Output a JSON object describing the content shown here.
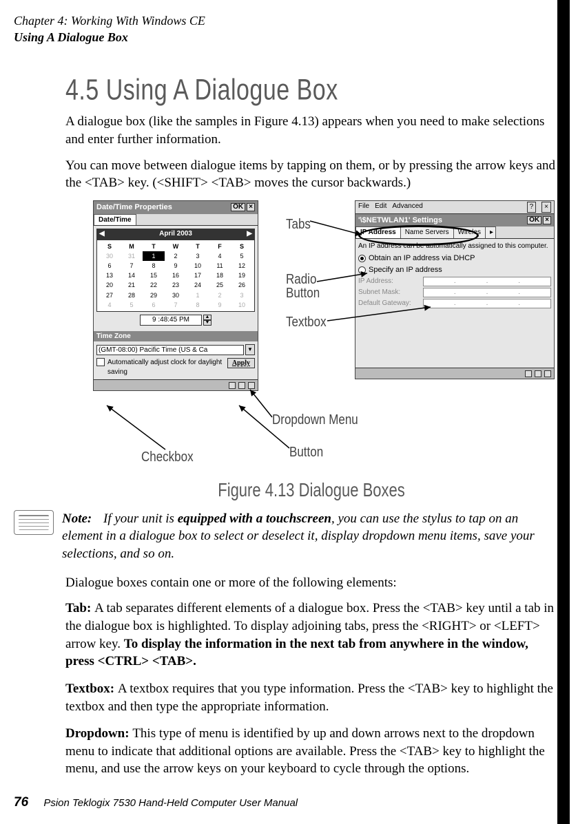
{
  "header": {
    "chapter": "Chapter 4: Working With Windows CE",
    "section": "Using A Dialogue Box"
  },
  "title": "4.5  Using A Dialogue Box",
  "intro1": "A dialogue box (like the samples in Figure 4.13) appears when you need to make selections and enter further information.",
  "intro2": "You can move between dialogue items by tapping on them, or by pressing the arrow keys and the <TAB> key. (<SHIFT> <TAB> moves the cursor backwards.)",
  "figure_caption": "Figure 4.13 Dialogue Boxes",
  "anno": {
    "tabs": "Tabs",
    "radio": "Radio",
    "radio2": "Button",
    "textbox": "Textbox",
    "dropdown": "Dropdown Menu",
    "checkbox": "Checkbox",
    "button": "Button"
  },
  "panel1": {
    "title": "Date/Time Properties",
    "ok": "OK",
    "close": "×",
    "tab": "Date/Time",
    "month": "April 2003",
    "days": [
      "S",
      "M",
      "T",
      "W",
      "T",
      "F",
      "S"
    ],
    "grid": [
      [
        "30",
        "31",
        "1",
        "2",
        "3",
        "4",
        "5"
      ],
      [
        "6",
        "7",
        "8",
        "9",
        "10",
        "11",
        "12"
      ],
      [
        "13",
        "14",
        "15",
        "16",
        "17",
        "18",
        "19"
      ],
      [
        "20",
        "21",
        "22",
        "23",
        "24",
        "25",
        "26"
      ],
      [
        "27",
        "28",
        "29",
        "30",
        "1",
        "2",
        "3"
      ],
      [
        "4",
        "5",
        "6",
        "7",
        "8",
        "9",
        "10"
      ]
    ],
    "time": "9 :48:45 PM",
    "tz_head": "Time Zone",
    "tz_value": "(GMT-08:00) Pacific Time (US & Ca",
    "check_label": "Automatically adjust clock for daylight saving",
    "apply": "Apply"
  },
  "panel2": {
    "menu": [
      "File",
      "Edit",
      "Advanced"
    ],
    "menu_q": "?",
    "menu_x": "×",
    "title": "'\\$NETWLAN1' Settings",
    "ok": "OK",
    "close": "×",
    "tabs": [
      "IP Address",
      "Name Servers",
      "Wireles"
    ],
    "scroll": "▸",
    "desc": "An IP address can be automatically assigned to this computer.",
    "radio1": "Obtain an IP address via DHCP",
    "radio2": "Specify an IP address",
    "f1": "IP Address:",
    "f2": "Subnet Mask:",
    "f3": "Default Gateway:",
    "dot": "."
  },
  "note": {
    "label": "Note:",
    "text_a": "If your unit is ",
    "text_b": "equipped with a touchscreen",
    "text_c": ", you can use the stylus to tap on an element in a dialogue box to select or deselect it, display dropdown menu items, save your selections, and so on."
  },
  "para_elements": "Dialogue boxes contain one or more of the following elements:",
  "def_tab": {
    "lead": "Tab: ",
    "body_a": "A tab separates different elements of a dialogue box. Press the <TAB> key until a tab in the dialogue box is highlighted. To display adjoining tabs, press the <RIGHT> or <LEFT> arrow key. ",
    "body_b": "To display the information in the next tab from anywhere in the window, press <CTRL> <TAB>."
  },
  "def_textbox": {
    "lead": "Textbox: ",
    "body": "A textbox requires that you type information. Press the <TAB> key to highlight the textbox and then type the appropriate information."
  },
  "def_dropdown": {
    "lead": "Dropdown: ",
    "body": "This type of menu is identified by up and down arrows next to the dropdown menu to indicate that additional options are available. Press the <TAB> key to highlight the menu, and use the arrow keys on your keyboard to cycle through the options."
  },
  "footer": {
    "page": "76",
    "book": "Psion Teklogix 7530 Hand-Held Computer User Manual"
  }
}
